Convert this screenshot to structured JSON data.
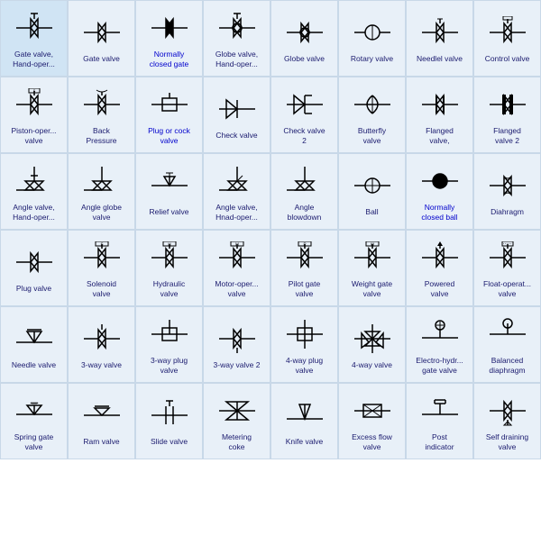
{
  "valves": [
    {
      "id": "gate-valve-hand",
      "label": "Gate valve,\nHand-oper...",
      "blue": false
    },
    {
      "id": "gate-valve",
      "label": "Gate valve",
      "blue": false
    },
    {
      "id": "normally-closed-gate",
      "label": "Normally\nclosed gate",
      "blue": true
    },
    {
      "id": "globe-valve-hand",
      "label": "Globe valve,\nHand-oper...",
      "blue": false
    },
    {
      "id": "globe-valve",
      "label": "Globe valve",
      "blue": false
    },
    {
      "id": "rotary-valve",
      "label": "Rotary valve",
      "blue": false
    },
    {
      "id": "needlel-valve",
      "label": "Needlel valve",
      "blue": false
    },
    {
      "id": "control-valve",
      "label": "Control valve",
      "blue": false
    },
    {
      "id": "piston-operated-valve",
      "label": "Piston-oper...\nvalve",
      "blue": false
    },
    {
      "id": "back-pressure",
      "label": "Back\nPressure",
      "blue": false
    },
    {
      "id": "plug-or-cock-valve",
      "label": "Plug or cock\nvalve",
      "blue": true
    },
    {
      "id": "check-valve",
      "label": "Check valve",
      "blue": false
    },
    {
      "id": "check-valve-2",
      "label": "Check valve\n2",
      "blue": false
    },
    {
      "id": "butterfly-valve",
      "label": "Butterfly\nvalve",
      "blue": false
    },
    {
      "id": "flanged-valve",
      "label": "Flanged\nvalve,",
      "blue": false
    },
    {
      "id": "flanged-valve-2",
      "label": "Flanged\nvalve 2",
      "blue": false
    },
    {
      "id": "angle-valve-hand",
      "label": "Angle valve,\nHand-oper...",
      "blue": false
    },
    {
      "id": "angle-globe-valve",
      "label": "Angle globe\nvalve",
      "blue": false
    },
    {
      "id": "relief-valve",
      "label": "Relief valve",
      "blue": false
    },
    {
      "id": "angle-valve-hnad",
      "label": "Angle valve,\nHnad-oper...",
      "blue": false
    },
    {
      "id": "angle-blowdown",
      "label": "Angle\nblowdown",
      "blue": false
    },
    {
      "id": "ball",
      "label": "Ball",
      "blue": false
    },
    {
      "id": "normally-closed-ball",
      "label": "Normally\nclosed ball",
      "blue": true
    },
    {
      "id": "diahragm",
      "label": "Diahragm",
      "blue": false
    },
    {
      "id": "plug-valve",
      "label": "Plug valve",
      "blue": false
    },
    {
      "id": "solenoid-valve",
      "label": "Solenoid\nvalve",
      "blue": false
    },
    {
      "id": "hydraulic-valve",
      "label": "Hydraulic\nvalve",
      "blue": false
    },
    {
      "id": "motor-oper-valve",
      "label": "Motor-oper...\nvalve",
      "blue": false
    },
    {
      "id": "pilot-gate-valve",
      "label": "Pilot gate\nvalve",
      "blue": false
    },
    {
      "id": "weight-gate-valve",
      "label": "Weight gate\nvalve",
      "blue": false
    },
    {
      "id": "powered-valve",
      "label": "Powered\nvalve",
      "blue": false
    },
    {
      "id": "float-operat-valve",
      "label": "Float-operat...\nvalve",
      "blue": false
    },
    {
      "id": "needle-valve",
      "label": "Needle valve",
      "blue": false
    },
    {
      "id": "3way-valve",
      "label": "3-way valve",
      "blue": false
    },
    {
      "id": "3way-plug-valve",
      "label": "3-way plug\nvalve",
      "blue": false
    },
    {
      "id": "3way-valve-2",
      "label": "3-way valve 2",
      "blue": false
    },
    {
      "id": "4way-plug-valve",
      "label": "4-way plug\nvalve",
      "blue": false
    },
    {
      "id": "4way-valve",
      "label": "4-way valve",
      "blue": false
    },
    {
      "id": "electro-hydr-gate-valve",
      "label": "Electro-hydr...\ngate valve",
      "blue": false
    },
    {
      "id": "balanced-diaphragm",
      "label": "Balanced\ndiaphragm",
      "blue": false
    },
    {
      "id": "spring-gate-valve",
      "label": "Spring gate\nvalve",
      "blue": false
    },
    {
      "id": "ram-valve",
      "label": "Ram valve",
      "blue": false
    },
    {
      "id": "slide-valve",
      "label": "Slide valve",
      "blue": false
    },
    {
      "id": "metering-coke",
      "label": "Metering\ncoke",
      "blue": false
    },
    {
      "id": "knife-valve",
      "label": "Knife valve",
      "blue": false
    },
    {
      "id": "excess-flow-valve",
      "label": "Excess flow\nvalve",
      "blue": false
    },
    {
      "id": "post-indicator",
      "label": "Post\nindicator",
      "blue": false
    },
    {
      "id": "self-draining-valve",
      "label": "Self draining\nvalve",
      "blue": false
    }
  ]
}
